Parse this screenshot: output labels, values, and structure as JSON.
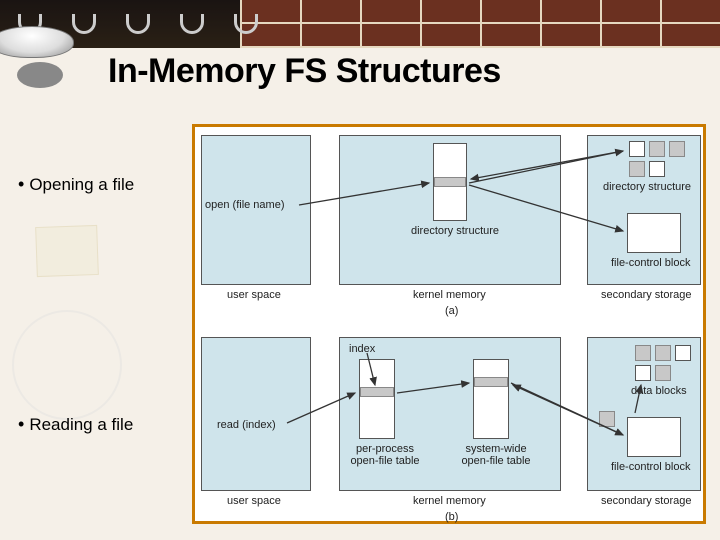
{
  "title": "In-Memory FS Structures",
  "bullets": {
    "open": "Opening a file",
    "read": "Reading a file"
  },
  "diagramA": {
    "open_call": "open (file name)",
    "dir_struct_center": "directory structure",
    "dir_struct_right": "directory structure",
    "fcb": "file-control block",
    "user_space": "user space",
    "kernel_memory": "kernel memory",
    "secondary_storage": "secondary storage",
    "caption": "(a)"
  },
  "diagramB": {
    "index": "index",
    "read_call": "read (index)",
    "per_process": "per-process\nopen-file table",
    "system_wide": "system-wide\nopen-file table",
    "data_blocks": "data blocks",
    "fcb": "file-control block",
    "user_space": "user space",
    "kernel_memory": "kernel memory",
    "secondary_storage": "secondary storage",
    "caption": "(b)"
  }
}
